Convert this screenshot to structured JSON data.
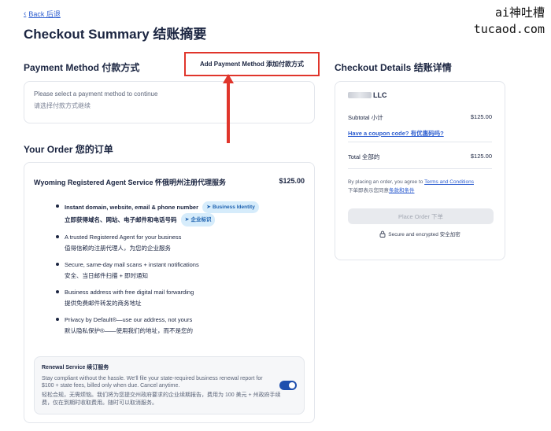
{
  "watermark": {
    "line1": "ai神吐槽",
    "line2": "tucaod.com"
  },
  "nav": {
    "back_label": "Back 后退"
  },
  "page": {
    "title": "Checkout Summary 结账摘要"
  },
  "payment": {
    "section_title": "Payment Method 付款方式",
    "add_button_label": "Add Payment Method 添加付款方式",
    "prompt_en": "Please select a payment method to continue",
    "prompt_zh": "请选择付款方式继续"
  },
  "order": {
    "section_title": "Your Order 您的订单",
    "service_name": "Wyoming Registered Agent Service 怀俄明州注册代理服务",
    "service_price": "$125.00",
    "features": [
      {
        "en": "Instant domain, website, email & phone number",
        "zh": "立即获得域名、网站、电子邮件和电话号码",
        "badge_en": "Business Identity",
        "badge_zh": "企业标识"
      },
      {
        "en": "A trusted Registered Agent for your business",
        "zh": "值得信赖的注册代理人，为您的企业服务"
      },
      {
        "en": "Secure, same-day mail scans + instant notifications",
        "zh": "安全、当日邮件扫描 + 即时通知"
      },
      {
        "en": "Business address with free digital mail forwarding",
        "zh": "提供免费邮件转发的商务地址"
      },
      {
        "en": "Privacy by Default®—use our address, not yours",
        "zh": "默认隐私保护®——使用我们的地址，而不是您的"
      }
    ],
    "renewal": {
      "title": "Renewal Service 续订服务",
      "desc_en": "Stay compliant without the hassle. We'll file your state-required business renewal report for $100 + state fees, billed only when due. Cancel anytime.",
      "desc_zh": "轻松合规，无需烦恼。我们将为您提交州政府要求的企业续期报告，费用为 100 美元 + 州政府手续费，仅在到期时收取费用。随时可以取消服务。",
      "enabled": true
    }
  },
  "details": {
    "section_title": "Checkout Details 结账详情",
    "company_suffix": "LLC",
    "subtotal_label": "Subtotal 小计",
    "subtotal_value": "$125.00",
    "coupon_link": "Have a coupon code? 有优惠码吗?",
    "total_label": "Total 全部的",
    "total_value": "$125.00",
    "terms_prefix": "By placing an order, you agree to ",
    "terms_link": "Terms and Conditions",
    "terms_zh_prefix": "下单即表示您同意",
    "terms_zh_link": "条款和条件",
    "place_order_label": "Place Order 下单",
    "secure_label": "Secure and encrypted 安全加密"
  },
  "colors": {
    "accent": "#2f5fd0",
    "highlight_border": "#e0352b",
    "toggle": "#1e4fae",
    "badge_bg": "#d6ecfb"
  }
}
